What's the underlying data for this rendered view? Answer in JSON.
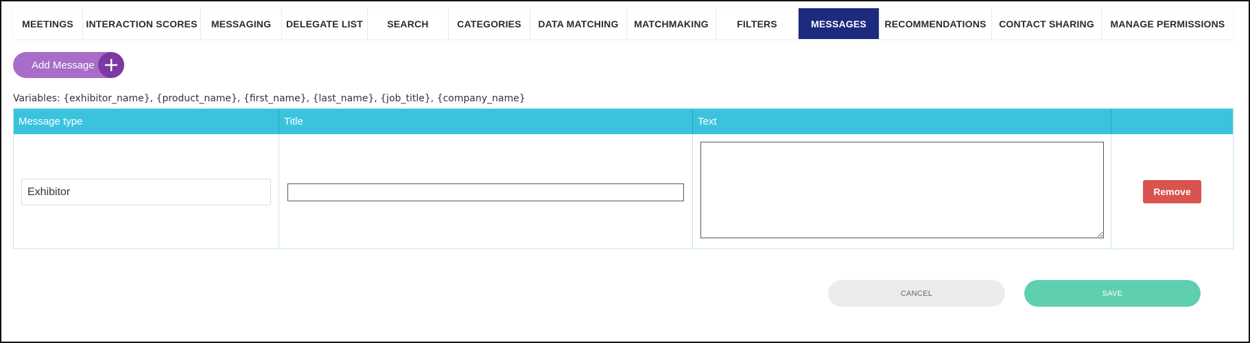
{
  "tabs": [
    {
      "label": "MEETINGS",
      "active": false
    },
    {
      "label": "INTERACTION SCORES",
      "active": false
    },
    {
      "label": "MESSAGING",
      "active": false
    },
    {
      "label": "DELEGATE LIST",
      "active": false
    },
    {
      "label": "SEARCH",
      "active": false
    },
    {
      "label": "CATEGORIES",
      "active": false
    },
    {
      "label": "DATA MATCHING",
      "active": false
    },
    {
      "label": "MATCHMAKING",
      "active": false
    },
    {
      "label": "FILTERS",
      "active": false
    },
    {
      "label": "MESSAGES",
      "active": true
    },
    {
      "label": "RECOMMENDATIONS",
      "active": false
    },
    {
      "label": "CONTACT SHARING",
      "active": false
    },
    {
      "label": "MANAGE PERMISSIONS",
      "active": false
    }
  ],
  "add_message": {
    "label": "Add Message",
    "icon": "plus-icon"
  },
  "variables_text": "Variables: {exhibitor_name}, {product_name}, {first_name}, {last_name}, {job_title}, {company_name}",
  "table": {
    "headers": [
      "Message type",
      "Title",
      "Text",
      ""
    ],
    "rows": [
      {
        "message_type": "Exhibitor",
        "title": "",
        "text": "",
        "remove_label": "Remove"
      }
    ]
  },
  "actions": {
    "cancel_label": "CANCEL",
    "save_label": "SAVE"
  },
  "colors": {
    "active_tab": "#1d2a7e",
    "add_button": "#a86cc9",
    "table_header": "#3bc3de",
    "remove_button": "#d9534f",
    "save_button": "#5fcfb0",
    "cancel_button": "#ececec"
  }
}
